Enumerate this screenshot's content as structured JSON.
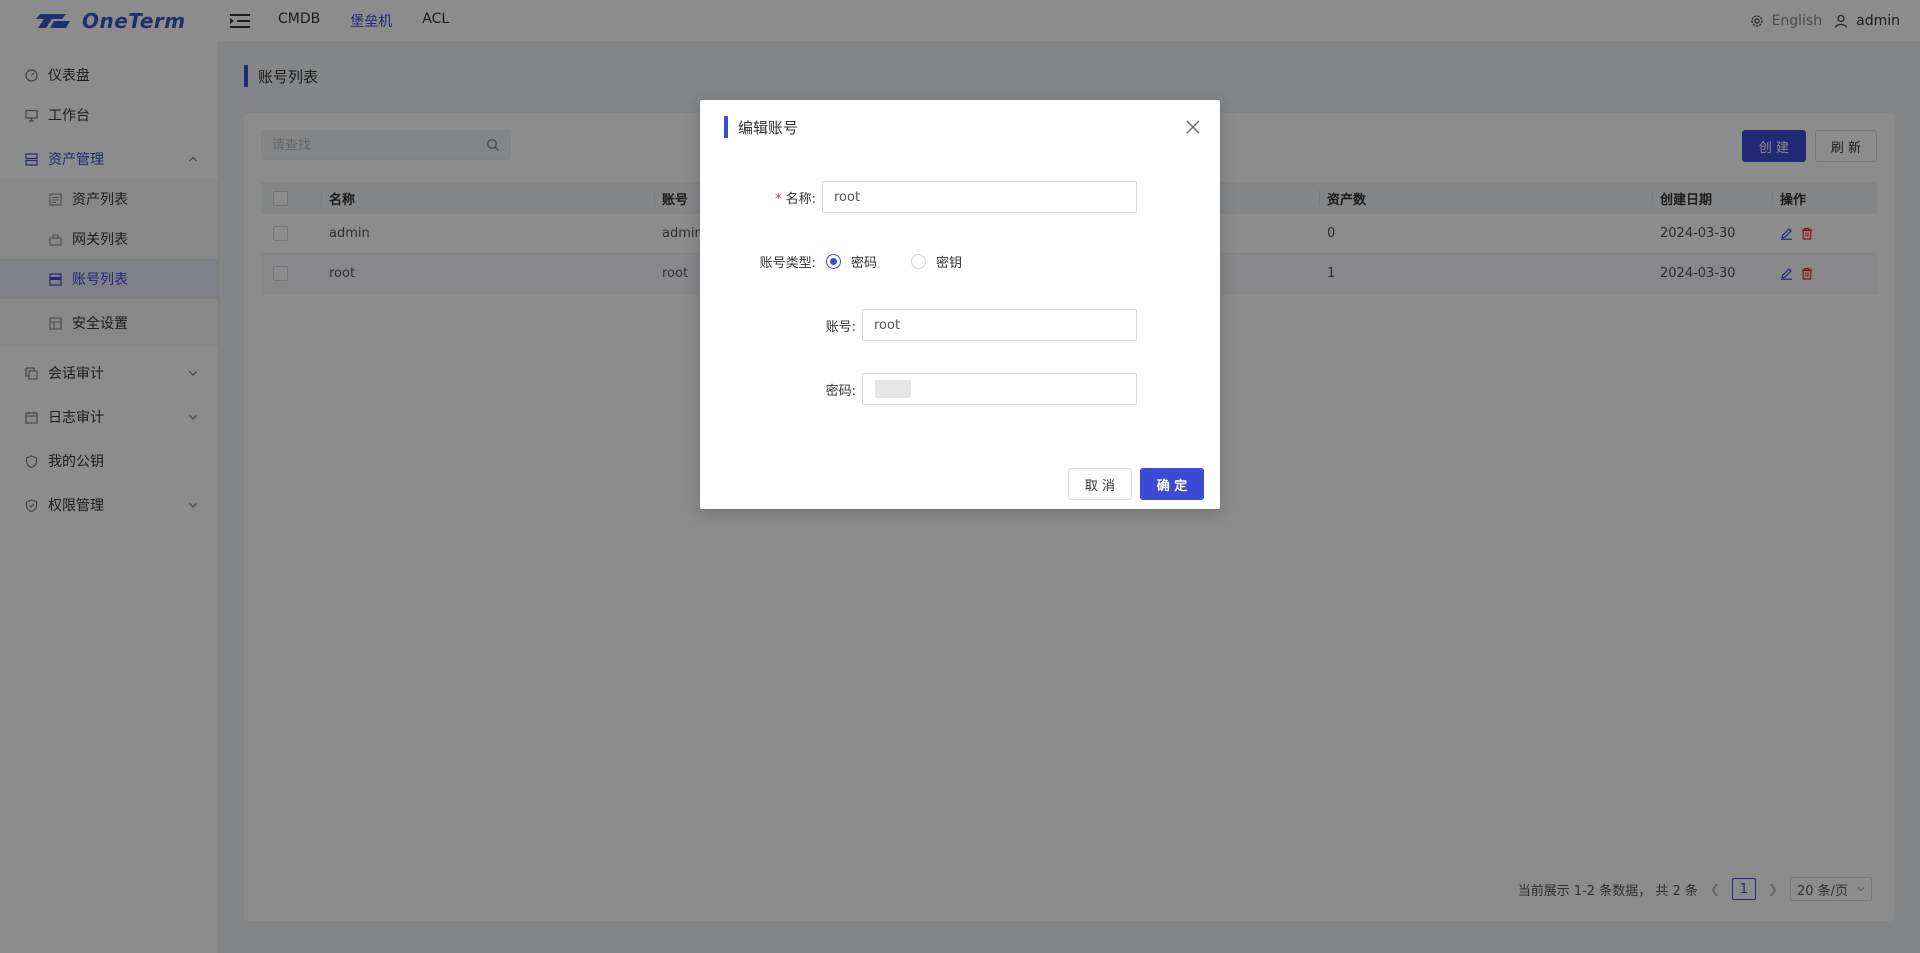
{
  "header": {
    "logo_text": "OneTerm",
    "nav": [
      "CMDB",
      "堡垒机",
      "ACL"
    ],
    "active_nav_index": 1,
    "language": "English",
    "username": "admin"
  },
  "sidebar": {
    "items": [
      {
        "label": "仪表盘",
        "icon": "dashboard-icon"
      },
      {
        "label": "工作台",
        "icon": "monitor-icon"
      },
      {
        "label": "资产管理",
        "icon": "server-icon",
        "expanded": true
      },
      {
        "label": "会话审计",
        "icon": "copy-icon",
        "expanded": false
      },
      {
        "label": "日志审计",
        "icon": "calendar-icon",
        "expanded": false
      },
      {
        "label": "我的公钥",
        "icon": "shield-icon"
      },
      {
        "label": "权限管理",
        "icon": "shield-check-icon",
        "expanded": false
      }
    ],
    "asset_sub_items": [
      {
        "label": "资产列表",
        "icon": "list-icon"
      },
      {
        "label": "网关列表",
        "icon": "gateway-icon"
      },
      {
        "label": "账号列表",
        "icon": "account-icon",
        "active": true
      },
      {
        "label": "安全设置",
        "icon": "settings-icon"
      }
    ]
  },
  "page": {
    "title": "账号列表",
    "search_placeholder": "请查找",
    "create_label": "创 建",
    "refresh_label": "刷 新"
  },
  "table": {
    "columns": [
      "名称",
      "账号",
      "资产数",
      "创建日期",
      "操作"
    ],
    "rows": [
      {
        "name": "admin",
        "account": "admin",
        "asset_count": "0",
        "created": "2024-03-30"
      },
      {
        "name": "root",
        "account": "root",
        "asset_count": "1",
        "created": "2024-03-30"
      }
    ]
  },
  "pagination": {
    "summary": "当前展示 1-2 条数据，  共 2 条",
    "current_page": "1",
    "page_size": "20 条/页"
  },
  "modal": {
    "title": "编辑账号",
    "name_label": "名称:",
    "name_value": "root",
    "type_label": "账号类型:",
    "type_options": [
      "密码",
      "密钥"
    ],
    "type_selected": 0,
    "account_label": "账号:",
    "account_value": "root",
    "password_label": "密码:",
    "cancel_label": "取 消",
    "ok_label": "确 定"
  },
  "colors": {
    "primary": "#3c4ad8",
    "danger": "#f5222d"
  }
}
